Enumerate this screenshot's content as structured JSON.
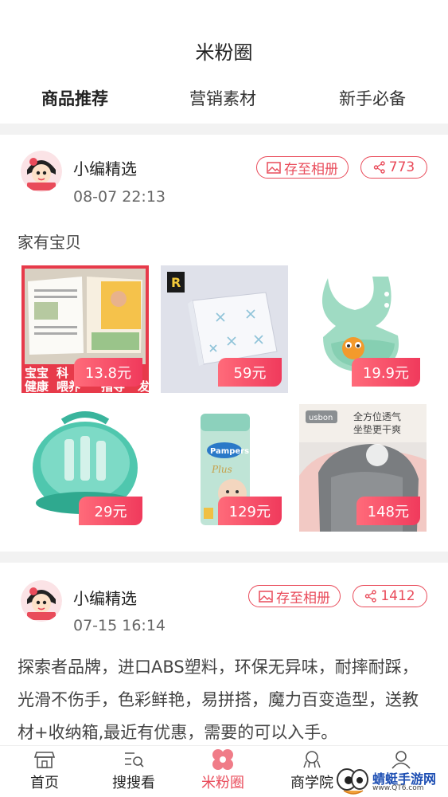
{
  "header": {
    "title": "米粉圈",
    "tabs": [
      {
        "label": "商品推荐",
        "active": true
      },
      {
        "label": "营销素材",
        "active": false
      },
      {
        "label": "新手必备",
        "active": false
      }
    ]
  },
  "posts": [
    {
      "author": "小编精选",
      "time": "08-07 22:13",
      "save_label": "存至相册",
      "share_count": "773",
      "text": "家有宝贝",
      "products": [
        {
          "image": "book-icon",
          "price": "13.8元",
          "overlay": [
            "宝宝",
            "健康",
            "科",
            "喂养",
            "指导",
            "发"
          ]
        },
        {
          "image": "muslin-blanket-icon",
          "price": "59元",
          "overlay": [
            "R"
          ]
        },
        {
          "image": "silicone-bib-icon",
          "price": "19.9元"
        },
        {
          "image": "bottle-sterilizer-icon",
          "price": "29元"
        },
        {
          "image": "diaper-pack-icon",
          "price": "129元",
          "overlay": [
            "Pampers",
            "Plus"
          ]
        },
        {
          "image": "baby-seat-icon",
          "price": "148元",
          "overlay": [
            "usbon",
            "全方位透气",
            "坐垫更干爽"
          ]
        }
      ]
    },
    {
      "author": "小编精选",
      "time": "07-15 16:14",
      "save_label": "存至相册",
      "share_count": "1412",
      "text": "探索者品牌，进口ABS塑料，环保无异味，耐摔耐踩，光滑不伤手，色彩鲜艳，易拼搭，魔力百变造型，送教材+收纳箱,最近有优惠，需要的可以入手。"
    }
  ],
  "bottom_nav": [
    {
      "label": "首页",
      "icon": "shop-icon",
      "active": false
    },
    {
      "label": "搜搜看",
      "icon": "search-list-icon",
      "active": false
    },
    {
      "label": "米粉圈",
      "icon": "flower-icon",
      "active": true
    },
    {
      "label": "商学院",
      "icon": "academy-icon",
      "active": false
    },
    {
      "label": "",
      "icon": "user-icon",
      "active": false
    }
  ],
  "watermark": {
    "title": "蜻蜓手游网",
    "subtitle": "www.QT6.com"
  },
  "colors": {
    "accent": "#e94b5a",
    "background_gap": "#f2f2f2"
  }
}
